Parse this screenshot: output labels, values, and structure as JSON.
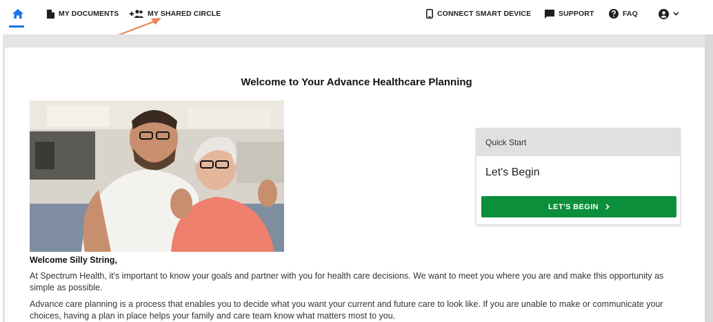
{
  "nav": {
    "home_icon": "home-icon",
    "my_documents": "MY DOCUMENTS",
    "my_shared_circle": "MY SHARED CIRCLE",
    "connect_smart_device": "CONNECT SMART DEVICE",
    "support": "SUPPORT",
    "faq": "FAQ",
    "account_icon": "account-circle-icon",
    "active_color": "#1a73e8"
  },
  "annotation": {
    "arrow_color": "#e8835a"
  },
  "main": {
    "title": "Welcome to Your Advance Healthcare Planning",
    "greeting": "Welcome Silly String,",
    "paragraph_1": "At Spectrum Health, it's important to know your goals and partner with you for health care decisions. We want to meet you where you are and make this opportunity as simple as possible.",
    "paragraph_2": "Advance care planning is a process that enables you to decide what you want your current and future care to look like. If you are unable to make or communicate your choices, having a plan in place helps your family and care team know what matters most to you."
  },
  "quick_start": {
    "header": "Quick Start",
    "subtitle": "Let's Begin",
    "button_label": "LET'S BEGIN",
    "button_color": "#0c8f3a"
  }
}
